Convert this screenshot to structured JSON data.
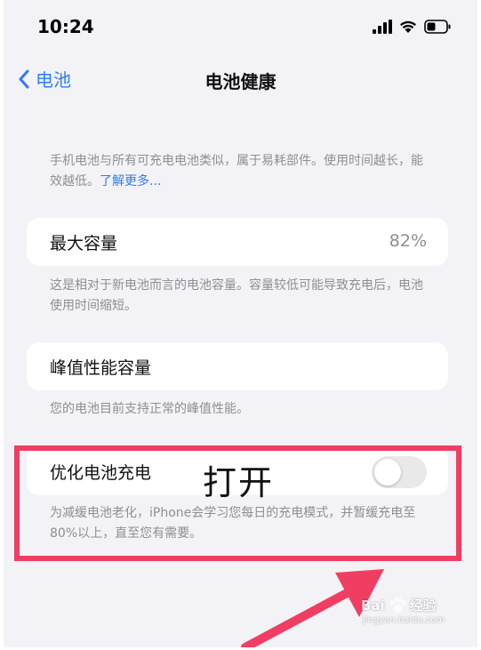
{
  "status_bar": {
    "time": "10:24"
  },
  "nav": {
    "back_label": "电池",
    "title": "电池健康"
  },
  "intro": {
    "text": "手机电池与所有可充电电池类似，属于易耗部件。使用时间越长，能效越低。",
    "link": "了解更多..."
  },
  "max_capacity": {
    "label": "最大容量",
    "value": "82%",
    "footnote": "这是相对于新电池而言的电池容量。容量较低可能导致充电后，电池使用时间缩短。"
  },
  "peak_performance": {
    "label": "峰值性能容量",
    "footnote": "您的电池目前支持正常的峰值性能。"
  },
  "optimized_charging": {
    "label": "优化电池充电",
    "enabled": false,
    "footnote": "为减缓电池老化，iPhone会学习您每日的充电模式，并暂缓充电至80%以上，直至您有需要。"
  },
  "annotation": {
    "text": "打开",
    "color": "#f03e63"
  },
  "watermark": {
    "brand": "Bai",
    "brand_suffix": "经验",
    "url": "jingyan.baidu.com"
  },
  "colors": {
    "accent": "#2f7cf6",
    "background": "#f2f2f7",
    "annotation_red": "#f03e63"
  }
}
